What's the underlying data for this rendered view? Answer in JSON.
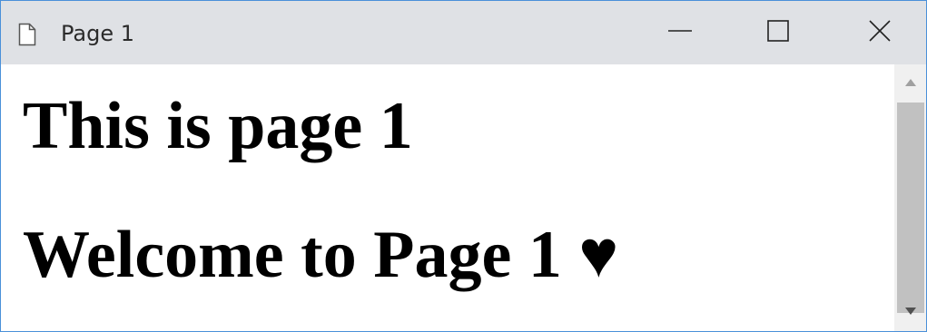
{
  "window": {
    "title": "Page 1",
    "icons": {
      "page": "page-icon",
      "minimize": "minimize-icon",
      "maximize": "maximize-icon",
      "close": "close-icon"
    }
  },
  "content": {
    "heading1": "This is page 1",
    "heading2": "Welcome to Page 1 ♥"
  },
  "scrollbar": {
    "icons": {
      "up": "scroll-up-icon",
      "down": "scroll-down-icon"
    }
  },
  "colors": {
    "titlebar": "#dfe1e5",
    "window_border": "#4a90d9",
    "scroll_thumb": "#c1c1c1"
  }
}
